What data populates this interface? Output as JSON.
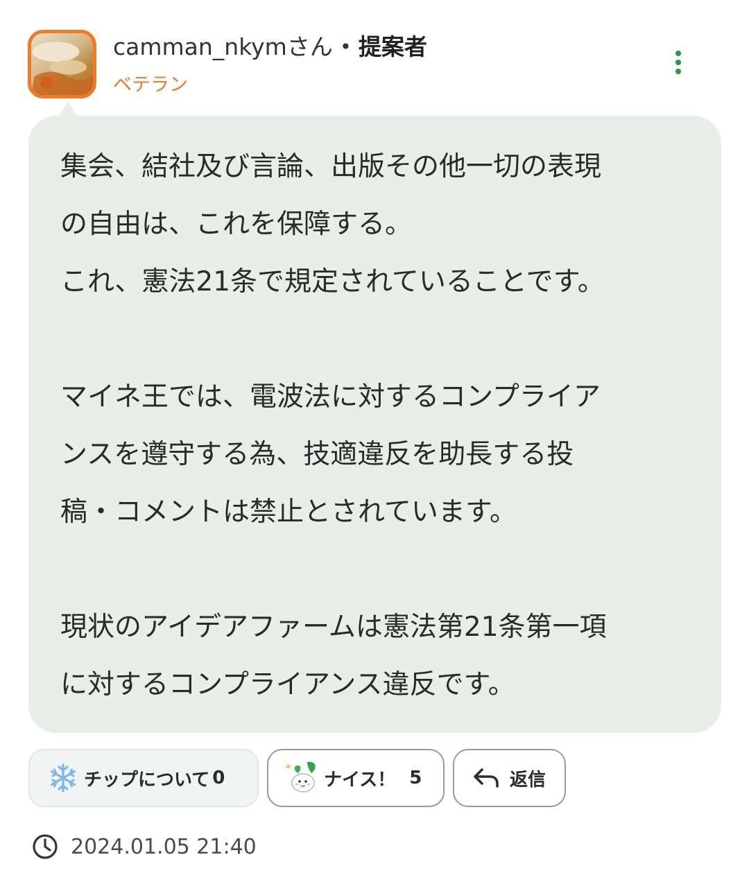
{
  "author": {
    "username": "camman_nkymさん",
    "separator": "・",
    "role": "提案者",
    "rank": "ベテラン"
  },
  "menu": {
    "icon": "more-vertical-icon"
  },
  "post": {
    "paragraphs": [
      [
        "集会、結社及び言論、出版その他一切の表現",
        "の自由は、これを保障する。",
        "これ、憲法21条で規定されていることです。"
      ],
      [
        "マイネ王では、電波法に対するコンプライア",
        "ンスを遵守する為、技適違反を助長する投",
        "稿・コメントは禁止とされています。"
      ],
      [
        "現状のアイデアファームは憲法第21条第一項",
        "に対するコンプライアンス違反です。"
      ]
    ]
  },
  "actions": {
    "tip": {
      "icon": "snowflake-icon",
      "label": "チップについて",
      "count": "0"
    },
    "nice": {
      "icon": "radish-mascot-icon",
      "label": "ナイス！",
      "count": "5"
    },
    "reply": {
      "icon": "reply-arrow-icon",
      "label": "返信"
    }
  },
  "meta": {
    "icon": "clock-icon",
    "timestamp": "2024.01.05 21:40"
  },
  "colors": {
    "accent_orange": "#ee7a2a",
    "accent_green": "#1e9a4a",
    "bubble_bg": "#e9eeea"
  }
}
